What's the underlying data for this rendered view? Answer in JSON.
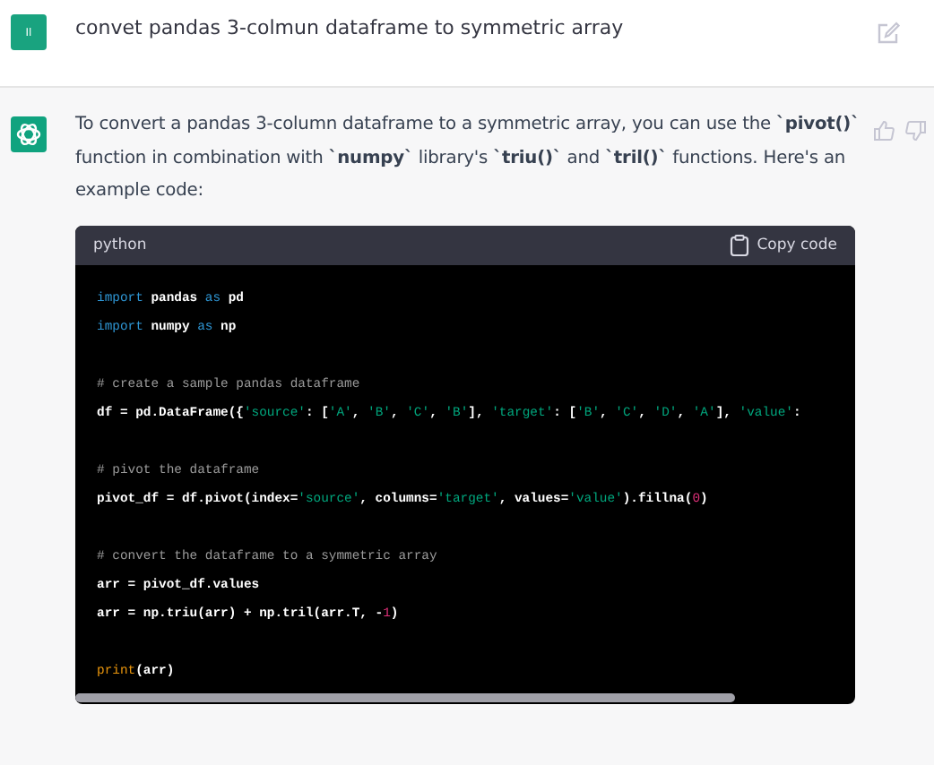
{
  "user_message": {
    "avatar": "Il",
    "text": "convet pandas 3-colmun dataframe to symmetric array"
  },
  "assistant_message": {
    "paragraph": "To convert a pandas 3-column dataframe to a symmetric array, you can use the **`pivot()`** function in combination with **`numpy`** library's **`triu()`** and **`tril()`** functions. Here's an example code:",
    "code_block": {
      "language": "python",
      "copy_label": "Copy code",
      "line_groups": [
        [
          [
            {
              "kind": "keyword",
              "text": "import"
            },
            {
              "kind": "plain",
              "text": " pandas "
            },
            {
              "kind": "keyword",
              "text": "as"
            },
            {
              "kind": "plain",
              "text": " pd"
            }
          ],
          [
            {
              "kind": "keyword",
              "text": "import"
            },
            {
              "kind": "plain",
              "text": " numpy "
            },
            {
              "kind": "keyword",
              "text": "as"
            },
            {
              "kind": "plain",
              "text": " np"
            }
          ]
        ],
        [
          [
            {
              "kind": "comment",
              "text": "# create a sample pandas dataframe"
            }
          ],
          [
            {
              "kind": "plain",
              "text": "df = pd.DataFrame({"
            },
            {
              "kind": "string",
              "text": "'source'"
            },
            {
              "kind": "plain",
              "text": ": ["
            },
            {
              "kind": "string",
              "text": "'A'"
            },
            {
              "kind": "plain",
              "text": ", "
            },
            {
              "kind": "string",
              "text": "'B'"
            },
            {
              "kind": "plain",
              "text": ", "
            },
            {
              "kind": "string",
              "text": "'C'"
            },
            {
              "kind": "plain",
              "text": ", "
            },
            {
              "kind": "string",
              "text": "'B'"
            },
            {
              "kind": "plain",
              "text": "], "
            },
            {
              "kind": "string",
              "text": "'target'"
            },
            {
              "kind": "plain",
              "text": ": ["
            },
            {
              "kind": "string",
              "text": "'B'"
            },
            {
              "kind": "plain",
              "text": ", "
            },
            {
              "kind": "string",
              "text": "'C'"
            },
            {
              "kind": "plain",
              "text": ", "
            },
            {
              "kind": "string",
              "text": "'D'"
            },
            {
              "kind": "plain",
              "text": ", "
            },
            {
              "kind": "string",
              "text": "'A'"
            },
            {
              "kind": "plain",
              "text": "], "
            },
            {
              "kind": "string",
              "text": "'value'"
            },
            {
              "kind": "plain",
              "text": ":"
            }
          ]
        ],
        [
          [
            {
              "kind": "comment",
              "text": "# pivot the dataframe"
            }
          ],
          [
            {
              "kind": "plain",
              "text": "pivot_df = df.pivot(index="
            },
            {
              "kind": "string",
              "text": "'source'"
            },
            {
              "kind": "plain",
              "text": ", columns="
            },
            {
              "kind": "string",
              "text": "'target'"
            },
            {
              "kind": "plain",
              "text": ", values="
            },
            {
              "kind": "string",
              "text": "'value'"
            },
            {
              "kind": "plain",
              "text": ").fillna("
            },
            {
              "kind": "number",
              "text": "0"
            },
            {
              "kind": "plain",
              "text": ")"
            }
          ]
        ],
        [
          [
            {
              "kind": "comment",
              "text": "# convert the dataframe to a symmetric array"
            }
          ],
          [
            {
              "kind": "plain",
              "text": "arr = pivot_df.values"
            }
          ],
          [
            {
              "kind": "plain",
              "text": "arr = np.triu(arr) + np.tril(arr.T, -"
            },
            {
              "kind": "number",
              "text": "1"
            },
            {
              "kind": "plain",
              "text": ")"
            }
          ]
        ],
        [
          [
            {
              "kind": "builtin",
              "text": "print"
            },
            {
              "kind": "plain",
              "text": "(arr)"
            }
          ]
        ]
      ]
    }
  }
}
